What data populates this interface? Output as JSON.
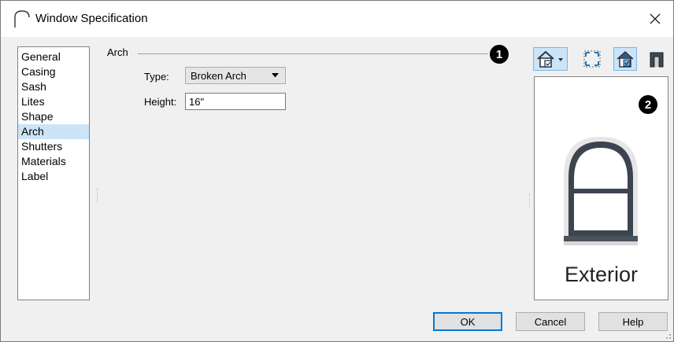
{
  "window": {
    "title": "Window Specification",
    "close_glyph": "✕"
  },
  "nav": {
    "items": [
      "General",
      "Casing",
      "Sash",
      "Lites",
      "Shape",
      "Arch",
      "Shutters",
      "Materials",
      "Label"
    ],
    "selected": "Arch"
  },
  "arch": {
    "group_label": "Arch",
    "type_label": "Type:",
    "type_value": "Broken Arch",
    "height_label": "Height:",
    "height_value": "16\""
  },
  "callouts": {
    "first": "1",
    "second": "2"
  },
  "toolbar": {
    "camera_icon": "camera-view-icon",
    "fill_icon": "fill-window-icon",
    "color_icon": "color-on-icon",
    "section_icon": "cross-section-icon"
  },
  "preview": {
    "caption": "Exterior"
  },
  "buttons": {
    "ok": "OK",
    "cancel": "Cancel",
    "help": "Help"
  },
  "colors": {
    "selection": "#cce4f7",
    "accent": "#0078d7"
  }
}
